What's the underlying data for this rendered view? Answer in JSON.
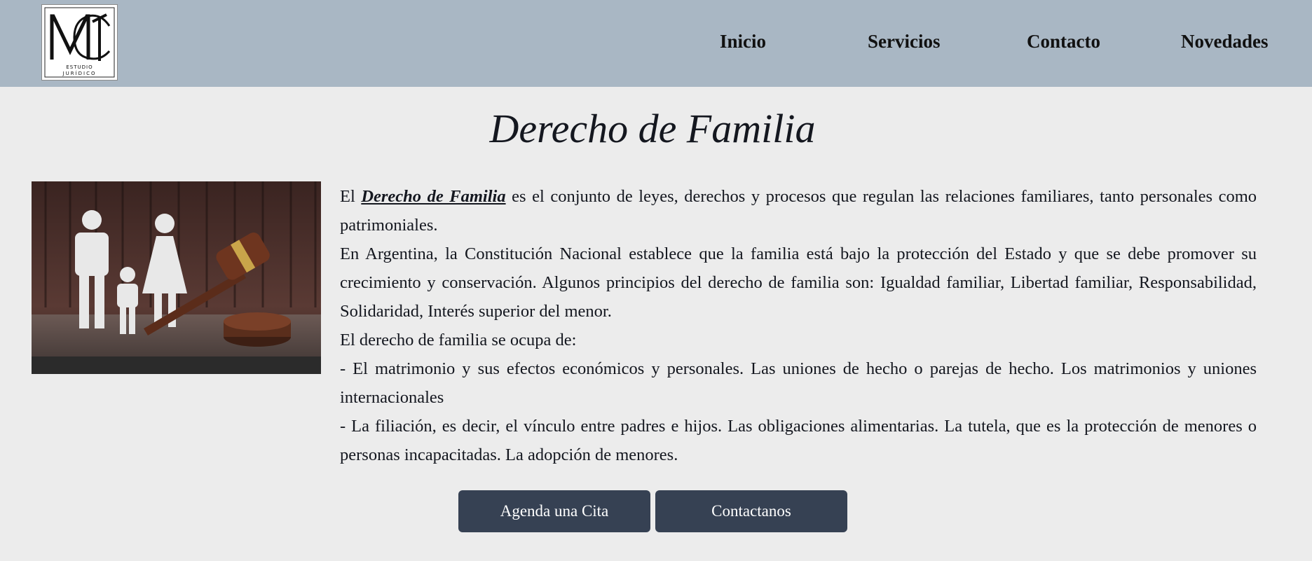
{
  "brand": {
    "logo_text": "ESTUDIO JURÍDICO"
  },
  "nav": {
    "items": [
      {
        "label": "Inicio"
      },
      {
        "label": "Servicios"
      },
      {
        "label": "Contacto"
      },
      {
        "label": "Novedades"
      }
    ]
  },
  "main": {
    "title": "Derecho de Familia",
    "intro_prefix": "El",
    "intro_highlight": "Derecho de Familia",
    "intro_rest": "es el conjunto de leyes, derechos y procesos que regulan las relaciones familiares, tanto personales como patrimoniales.",
    "paragraph_2": "En Argentina, la Constitución Nacional establece que la familia está bajo la protección del Estado y que se debe promover su crecimiento y conservación. Algunos principios del derecho de familia son: Igualdad familiar, Libertad familiar, Responsabilidad, Solidaridad, Interés superior del menor.",
    "paragraph_3": "El derecho de familia se ocupa de:",
    "bullet_1": "- El matrimonio y sus efectos económicos y personales. Las uniones de hecho o parejas de hecho. Los matrimonios y uniones internacionales",
    "bullet_2": "- La filiación, es decir, el vínculo entre padres e hijos. Las obligaciones alimentarias. La tutela, que es la protección de menores o personas incapacitadas. La adopción de menores."
  },
  "buttons": {
    "appointment_label": "Agenda una Cita",
    "contact_label": "Contactanos"
  },
  "colors": {
    "header_bg": "#a9b7c4",
    "page_bg": "#ececec",
    "button_bg": "#364153",
    "text": "#14171f"
  }
}
